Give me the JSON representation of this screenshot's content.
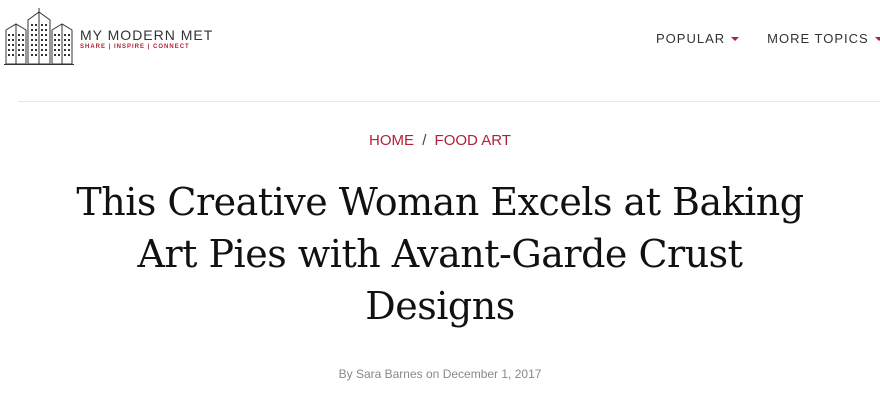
{
  "header": {
    "logo": {
      "name": "MY MODERN MET",
      "tagline": "SHARE | INSPIRE | CONNECT",
      "icon": "city-buildings-logo-icon"
    },
    "nav": [
      {
        "label": "POPULAR",
        "icon": "caret-down-icon"
      },
      {
        "label": "MORE TOPICS",
        "icon": "caret-down-icon"
      }
    ]
  },
  "breadcrumb": {
    "home": "HOME",
    "separator": "/",
    "category": "FOOD ART"
  },
  "article": {
    "title": "This Creative Woman Excels at Baking Art Pies with Avant-Garde Crust Designs",
    "byline_prefix": "By",
    "author": "Sara Barnes",
    "byline_connector": "on",
    "date": "December 1, 2017"
  },
  "colors": {
    "accent": "#b3203a",
    "text": "#111111",
    "muted": "#888888",
    "divider": "#e6e6e6"
  }
}
